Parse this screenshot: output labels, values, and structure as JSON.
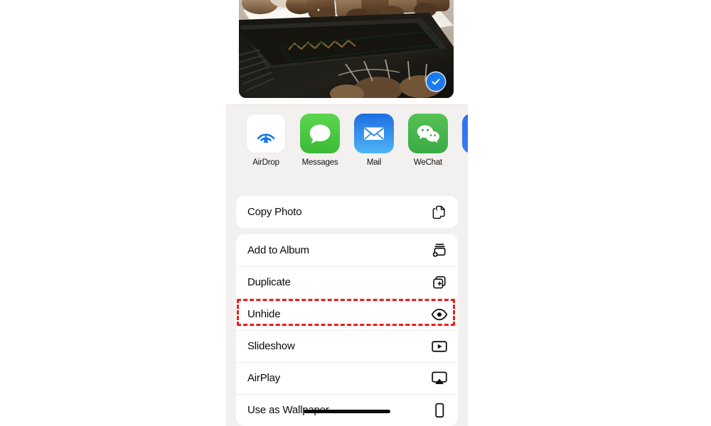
{
  "screen": {
    "app": "Photos",
    "sheet_type": "share-sheet",
    "background_color": "#ffffff",
    "sheet_color": "#f2f1ef"
  },
  "photo_preview": {
    "name": "selected-photo",
    "description": "Grilled meat slices on parchment paper over a dark grill tray",
    "selected": true,
    "badge_icon": "checkmark-circle-icon",
    "badge_color": "#1a7af0"
  },
  "share_apps": [
    {
      "label": "AirDrop",
      "icon": "airdrop-icon",
      "color": "#ffffff"
    },
    {
      "label": "Messages",
      "icon": "messages-icon",
      "color": "#3cba36"
    },
    {
      "label": "Mail",
      "icon": "mail-icon",
      "color": "#1d6ee0"
    },
    {
      "label": "WeChat",
      "icon": "wechat-icon",
      "color": "#3aaa45"
    },
    {
      "label": "",
      "icon": "partial-app-icon",
      "color": "#2f6df0"
    }
  ],
  "action_groups": [
    {
      "name": "copy-group",
      "rows": [
        {
          "label": "Copy Photo",
          "icon": "copy-photo-icon",
          "highlighted": false
        }
      ]
    },
    {
      "name": "actions-group",
      "rows": [
        {
          "label": "Add to Album",
          "icon": "add-to-album-icon",
          "highlighted": false
        },
        {
          "label": "Duplicate",
          "icon": "duplicate-icon",
          "highlighted": false
        },
        {
          "label": "Unhide",
          "icon": "eye-icon",
          "highlighted": true
        },
        {
          "label": "Slideshow",
          "icon": "slideshow-play-icon",
          "highlighted": false
        },
        {
          "label": "AirPlay",
          "icon": "airplay-icon",
          "highlighted": false
        },
        {
          "label": "Use as Wallpaper",
          "icon": "wallpaper-phone-icon",
          "highlighted": false
        }
      ]
    }
  ],
  "annotation": {
    "name": "unhide-highlight",
    "target_label": "Unhide",
    "style": "red-dashed-box",
    "color": "#ef1b1b"
  },
  "home_indicator": {
    "name": "home-indicator",
    "visible": true
  }
}
